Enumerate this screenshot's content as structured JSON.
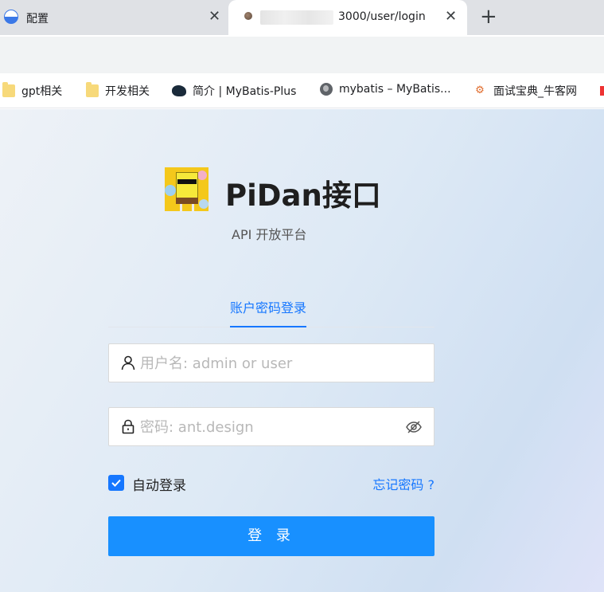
{
  "browser": {
    "tabs": [
      {
        "title": "配置",
        "favicon": "half-circle-icon",
        "close": "✕"
      },
      {
        "title": "3000/user/login",
        "favicon": "round-icon",
        "close": "✕"
      }
    ],
    "new_tab": "+"
  },
  "bookmarks": [
    {
      "label": "gpt相关",
      "icon": "folder-icon"
    },
    {
      "label": "开发相关",
      "icon": "folder-icon"
    },
    {
      "label": "简介 | MyBatis-Plus",
      "icon": "bird-icon"
    },
    {
      "label": "mybatis – MyBatis...",
      "icon": "globe-icon"
    },
    {
      "label": "面试宝典_牛客网",
      "icon": "nowcoder-icon"
    }
  ],
  "login": {
    "app_title": "PiDan接口",
    "subtitle": "API 开放平台",
    "tab_label": "账户密码登录",
    "username_placeholder": "用户名: admin or user",
    "password_placeholder": "密码: ant.design",
    "auto_login_label": "自动登录",
    "auto_login_checked": true,
    "forgot_label": "忘记密码 ?",
    "submit_label": "登 录"
  },
  "colors": {
    "accent": "#1677ff",
    "button": "#1890ff"
  }
}
